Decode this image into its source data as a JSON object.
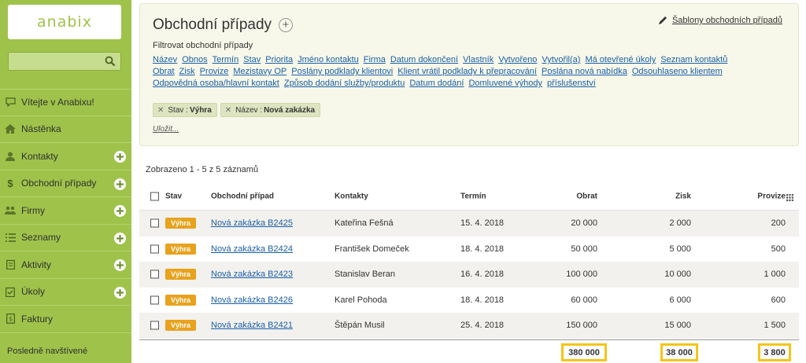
{
  "sidebar": {
    "logo": "anabix",
    "search": {
      "value": "",
      "placeholder": ""
    },
    "items": [
      {
        "label": "Vítejte v Anabixu!",
        "icon": "chat-bubble-icon",
        "has_plus": false
      },
      {
        "label": "Nástěnka",
        "icon": "home-icon",
        "has_plus": false
      },
      {
        "label": "Kontakty",
        "icon": "person-icon",
        "has_plus": true
      },
      {
        "label": "Obchodní případy",
        "icon": "dollar-icon",
        "has_plus": true
      },
      {
        "label": "Firmy",
        "icon": "people-icon",
        "has_plus": true
      },
      {
        "label": "Seznamy",
        "icon": "list-icon",
        "has_plus": true
      },
      {
        "label": "Aktivity",
        "icon": "clipboard-icon",
        "has_plus": true
      },
      {
        "label": "Úkoly",
        "icon": "checklist-icon",
        "has_plus": true
      },
      {
        "label": "Faktury",
        "icon": "invoice-icon",
        "has_plus": false
      }
    ],
    "recent_label": "Posledně navštívené"
  },
  "panel": {
    "title": "Obchodní případy",
    "title_plus": "+",
    "templates_link": "Šablony obchodních případů",
    "filter_label": "Filtrovat obchodní případy",
    "filter_rows": [
      [
        "Název",
        "Obnos",
        "Termín",
        "Stav",
        "Priorita",
        "Jméno kontaktu",
        "Firma",
        "Datum dokončení",
        "Vlastník",
        "Vytvořeno",
        "Vytvořil(a)",
        "Má otevřené úkoly",
        "Seznam kontaktů"
      ],
      [
        "Obrat",
        "Zisk",
        "Provize",
        "Mezistavy OP",
        "Poslány podklady klientovi",
        "Klient vrátil podklady k přepracování",
        "Poslána nová nabídka",
        "Odsouhlaseno klientem"
      ],
      [
        "Odpovědná osoba/hlavní kontakt",
        "Způsob dodání služby/produktu",
        "Datum dodání",
        "Domluvené výhody",
        "příslušenství"
      ]
    ],
    "active_filters": [
      {
        "key": "Stav :",
        "value": "Výhra"
      },
      {
        "key": "Název :",
        "value": "Nová zakázka"
      }
    ],
    "save_link": "Uložit..."
  },
  "results": {
    "count_text": "Zobrazeno 1 - 5 z 5 záznamů",
    "columns": {
      "stav": "Stav",
      "case": "Obchodní případ",
      "contact": "Kontakty",
      "term": "Termín",
      "obrat": "Obrat",
      "zisk": "Zisk",
      "provize": "Provize"
    },
    "rows": [
      {
        "stav": "Výhra",
        "case": "Nová zakázka B2425",
        "contact": "Kateřina Fešná",
        "term": "15. 4. 2018",
        "obrat": "20 000",
        "zisk": "2 000",
        "provize": "200"
      },
      {
        "stav": "Výhra",
        "case": "Nová zakázka B2424",
        "contact": "František Domeček",
        "term": "18. 4. 2018",
        "obrat": "50 000",
        "zisk": "5 000",
        "provize": "500"
      },
      {
        "stav": "Výhra",
        "case": "Nová zakázka B2423",
        "contact": "Stanislav Beran",
        "term": "16. 4. 2018",
        "obrat": "100 000",
        "zisk": "10 000",
        "provize": "1 000"
      },
      {
        "stav": "Výhra",
        "case": "Nová zakázka B2426",
        "contact": "Karel Pohoda",
        "term": "18. 4. 2018",
        "obrat": "60 000",
        "zisk": "6 000",
        "provize": "600"
      },
      {
        "stav": "Výhra",
        "case": "Nová zakázka B2421",
        "contact": "Štěpán Musil",
        "term": "25. 4. 2018",
        "obrat": "150 000",
        "zisk": "15 000",
        "provize": "1 500"
      }
    ],
    "totals": {
      "obrat": "380 000",
      "zisk": "38 000",
      "provize": "3 800"
    }
  },
  "colors": {
    "sidebar": "#9fc34a",
    "badge": "#e8a21c",
    "total_highlight": "#f5c518",
    "link": "#1a5fa8"
  }
}
